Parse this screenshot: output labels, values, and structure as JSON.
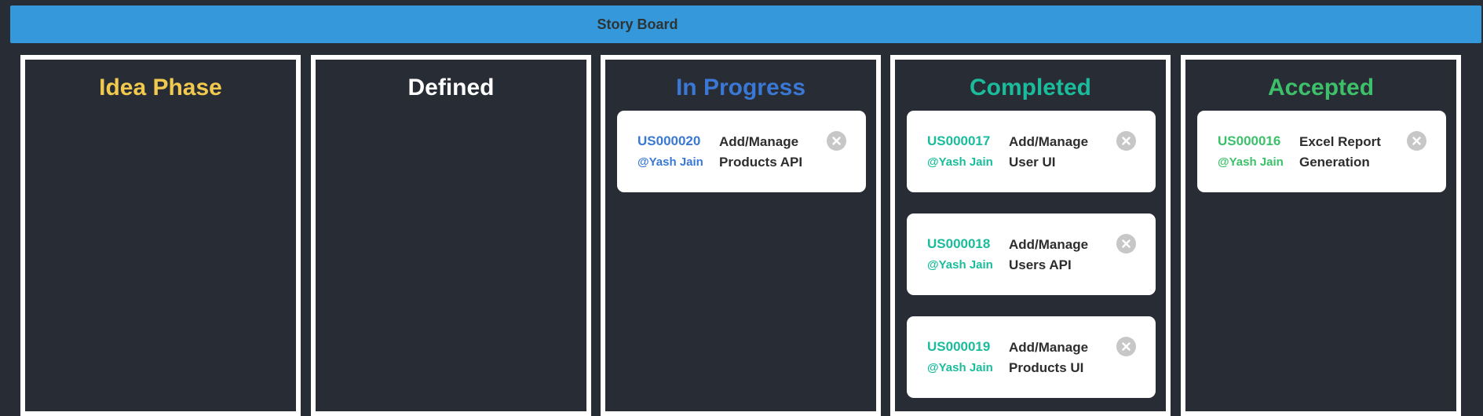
{
  "header": {
    "title": "Story Board",
    "background": "#3498db"
  },
  "columns": [
    {
      "title": "Idea Phase",
      "color": "#f1c94f",
      "cards": []
    },
    {
      "title": "Defined",
      "color": "#ffffff",
      "cards": []
    },
    {
      "title": "In Progress",
      "color": "#3a78d6",
      "cards": [
        {
          "id": "US000020",
          "owner": "@Yash Jain",
          "desc_line1": "Add/Manage",
          "desc_line2": "Products API",
          "close_icon": "close-circle-icon"
        }
      ]
    },
    {
      "title": "Completed",
      "color": "#1abc9c",
      "cards": [
        {
          "id": "US000017",
          "owner": "@Yash Jain",
          "desc_line1": "Add/Manage",
          "desc_line2": "User UI",
          "close_icon": "close-circle-icon"
        },
        {
          "id": "US000018",
          "owner": "@Yash Jain",
          "desc_line1": "Add/Manage",
          "desc_line2": "Users API",
          "close_icon": "close-circle-icon"
        },
        {
          "id": "US000019",
          "owner": "@Yash Jain",
          "desc_line1": "Add/Manage",
          "desc_line2": "Products UI",
          "close_icon": "close-circle-icon"
        }
      ]
    },
    {
      "title": "Accepted",
      "color": "#3cc06a",
      "cards": [
        {
          "id": "US000016",
          "owner": "@Yash Jain",
          "desc_line1": "Excel Report",
          "desc_line2": "Generation",
          "close_icon": "close-circle-icon"
        }
      ]
    }
  ]
}
